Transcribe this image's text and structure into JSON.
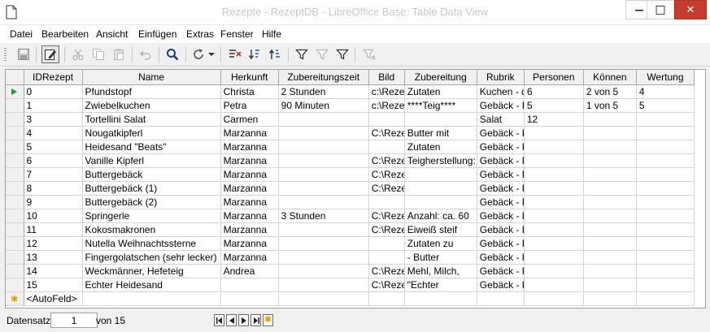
{
  "window": {
    "title": "Rezepte - RezeptDB - LibreOffice Base: Table Data View",
    "minimize_glyph": "—",
    "maximize_glyph": "□",
    "close_glyph": "✕"
  },
  "menu": [
    {
      "label": "Datei"
    },
    {
      "label": "Bearbeiten"
    },
    {
      "label": "Ansicht"
    },
    {
      "label": "Einfügen"
    },
    {
      "label": "Extras"
    },
    {
      "label": "Fenster"
    },
    {
      "label": "Hilfe"
    }
  ],
  "toolbar": {
    "icons": [
      "save-icon",
      "edit-mode-icon",
      "cut-icon",
      "copy-icon",
      "paste-icon",
      "undo-icon",
      "search-icon",
      "refresh-icon",
      "dropdown-arrow-icon",
      "sort-icon",
      "sort-ascending-icon",
      "sort-descending-icon",
      "autofilter-icon",
      "apply-filter-icon",
      "standard-filter-icon",
      "remove-filter-icon"
    ]
  },
  "grid": {
    "columns": [
      "IDRezept",
      "Name",
      "Herkunft",
      "Zubereitungszeit",
      "Bild",
      "Zubereitung",
      "Rubrik",
      "Personen",
      "Können",
      "Wertung"
    ],
    "rows": [
      [
        "0",
        "Pfundstopf",
        "Christa",
        "2 Stunden",
        "c:\\Rezep",
        "Zutaten",
        "Kuchen - d",
        "6",
        "2 von 5",
        "4"
      ],
      [
        "1",
        "Zwiebelkuchen",
        "Petra",
        "90 Minuten",
        "c:\\Rezep",
        "****Teig****",
        "Gebäck - P",
        "5",
        "1 von 5",
        "5"
      ],
      [
        "3",
        "Tortellini Salat",
        "Carmen",
        "",
        "",
        "",
        "Salat",
        "12",
        "",
        ""
      ],
      [
        "4",
        "Nougatkipferl",
        "Marzanna",
        "",
        "C:\\Reze",
        "Butter mit",
        "Gebäck - P",
        "",
        "",
        ""
      ],
      [
        "5",
        "Heidesand \"Beats\"",
        "Marzanna",
        "",
        "",
        "Zutaten",
        "Gebäck - P",
        "",
        "",
        ""
      ],
      [
        "6",
        "Vanille Kipferl",
        "Marzanna",
        "",
        "C:\\Reze",
        "Teigherstellung:",
        "Gebäck - P",
        "",
        "",
        ""
      ],
      [
        "7",
        "Buttergebäck",
        "Marzanna",
        "",
        "C:\\Reze",
        "",
        "Gebäck - P",
        "",
        "",
        ""
      ],
      [
        "8",
        "Buttergebäck (1)",
        "Marzanna",
        "",
        "C:\\Reze",
        "",
        "Gebäck - P",
        "",
        "",
        ""
      ],
      [
        "9",
        "Buttergebäck (2)",
        "Marzanna",
        "",
        "",
        "",
        "Gebäck - P",
        "",
        "",
        ""
      ],
      [
        "10",
        "Springerle",
        "Marzanna",
        "3 Stunden",
        "C:\\Reze",
        "Anzahl: ca. 60",
        "Gebäck - P",
        "",
        "",
        ""
      ],
      [
        "11",
        "Kokosmakronen",
        "Marzanna",
        "",
        "C:\\Reze",
        "Eiweiß steif",
        "Gebäck - P",
        "",
        "",
        ""
      ],
      [
        "12",
        "Nutella Weihnachtssterne",
        "Marzanna",
        "",
        "",
        "Zutaten zu",
        "Gebäck - P",
        "",
        "",
        ""
      ],
      [
        "13",
        "Fingergolatschen (sehr lecker)",
        "Marzanna",
        "",
        "",
        "- Butter",
        "Gebäck - P",
        "",
        "",
        ""
      ],
      [
        "14",
        "Weckmänner, Hefeteig",
        "Andrea",
        "",
        "C:\\Reze",
        "Mehl, Milch,",
        "Gebäck - P",
        "",
        "",
        ""
      ],
      [
        "15",
        "Echter Heidesand",
        "",
        "",
        "C:\\Reze",
        "\"Echter",
        "Gebäck - P",
        "",
        "",
        ""
      ]
    ],
    "autofield_label": "<AutoFeld>"
  },
  "status": {
    "record_label": "Datensatz",
    "record_value": "1",
    "of_label": "von 15"
  }
}
